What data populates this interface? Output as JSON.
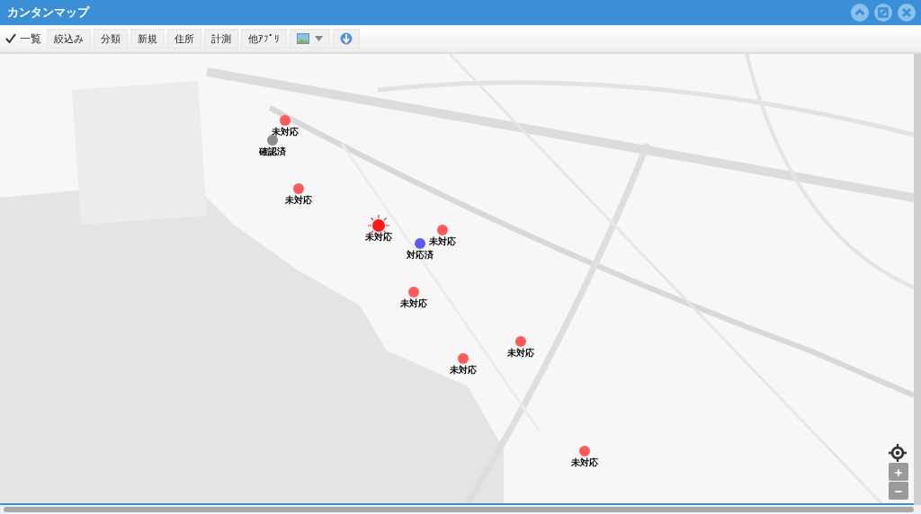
{
  "window": {
    "title": "カンタンマップ"
  },
  "toolbar": {
    "list_toggle": {
      "label": "一覧",
      "checked": true
    },
    "buttons": [
      "絞込み",
      "分類",
      "新規",
      "住所",
      "計測",
      "他ｱﾌﾟﾘ"
    ]
  },
  "map": {
    "markers": [
      {
        "label": "未対応",
        "color": "#ff5a5a",
        "alert": false
      },
      {
        "label": "確認済",
        "color": "#8c8c8c",
        "alert": false
      },
      {
        "label": "未対応",
        "color": "#ff5a5a",
        "alert": false
      },
      {
        "label": "未対応",
        "color": "#ff1a1a",
        "alert": true
      },
      {
        "label": "未対応",
        "color": "#ff5a5a",
        "alert": false
      },
      {
        "label": "対応済",
        "color": "#5a5aff",
        "alert": false
      },
      {
        "label": "未対応",
        "color": "#ff5a5a",
        "alert": false
      },
      {
        "label": "未対応",
        "color": "#ff5a5a",
        "alert": false
      },
      {
        "label": "未対応",
        "color": "#ff5a5a",
        "alert": false
      },
      {
        "label": "未対応",
        "color": "#ff5a5a",
        "alert": false
      }
    ],
    "zoom": {
      "in": "+",
      "out": "−"
    }
  }
}
